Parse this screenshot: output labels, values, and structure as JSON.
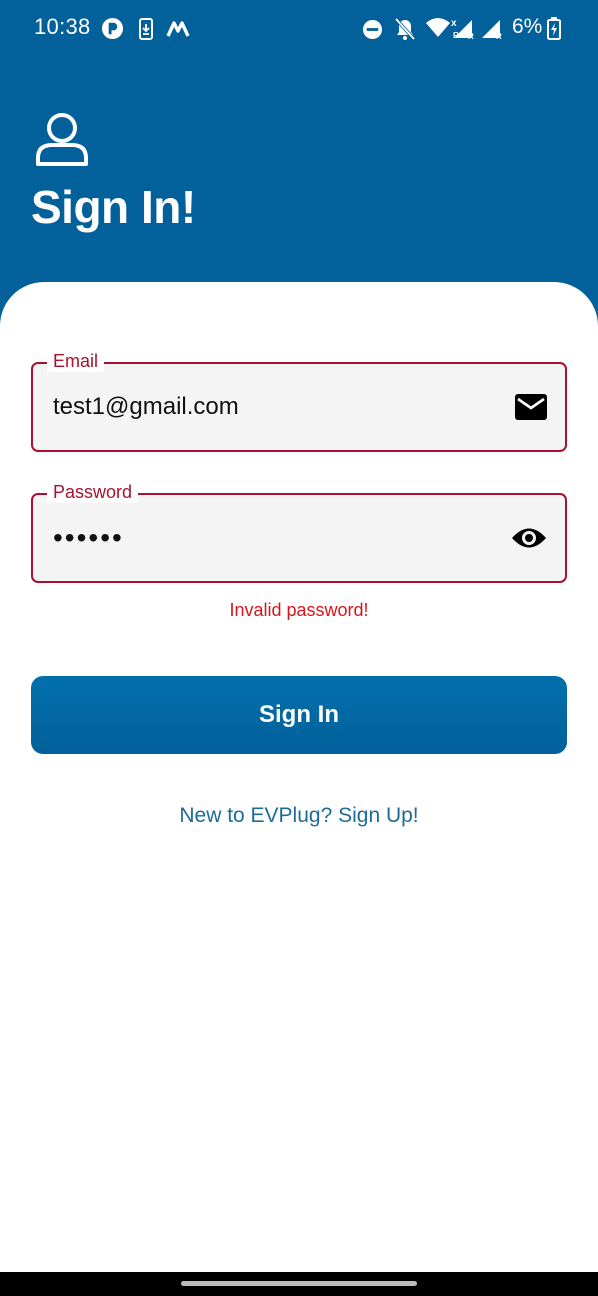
{
  "status_bar": {
    "time": "10:38",
    "battery_percent": "6%",
    "icons": [
      "app-r-icon",
      "download-icon",
      "maps-m-icon",
      "do-not-disturb-icon",
      "bell-muted-icon",
      "wifi-icon",
      "signal-icon",
      "signal-icon",
      "battery-icon"
    ]
  },
  "header": {
    "icon": "user-icon",
    "title": "Sign In!",
    "background_color": "#02609a"
  },
  "form": {
    "email": {
      "label": "Email",
      "value": "test1@gmail.com",
      "icon": "mail-icon"
    },
    "password": {
      "label": "Password",
      "value": "••••••",
      "icon": "eye-icon"
    },
    "error_text": "Invalid password!",
    "error_color": "#a8112f",
    "submit_label": "Sign In",
    "signup_link": "New to EVPlug? Sign Up!"
  }
}
